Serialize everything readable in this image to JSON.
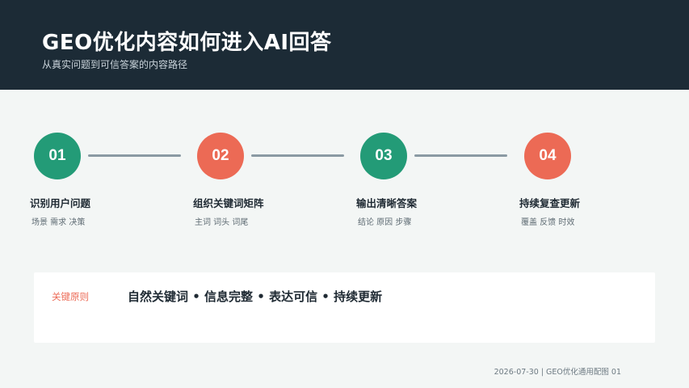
{
  "header": {
    "title": "GEO优化内容如何进入AI回答",
    "subtitle": "从真实问题到可信答案的内容路径"
  },
  "steps": [
    {
      "number": "01",
      "title": "识别用户问题",
      "desc": "场景 需求 决策",
      "color": "#239b77"
    },
    {
      "number": "02",
      "title": "组织关键词矩阵",
      "desc": "主词 词头 词尾",
      "color": "#ec6a55"
    },
    {
      "number": "03",
      "title": "输出清晰答案",
      "desc": "结论 原因 步骤",
      "color": "#239b77"
    },
    {
      "number": "04",
      "title": "持续复查更新",
      "desc": "覆盖 反馈 时效",
      "color": "#ec6a55"
    }
  ],
  "principles": {
    "label": "关键原则",
    "text": "自然关键词 • 信息完整 • 表达可信 • 持续更新"
  },
  "footer": {
    "text": "2026-07-30 | GEO优化通用配图 01"
  }
}
